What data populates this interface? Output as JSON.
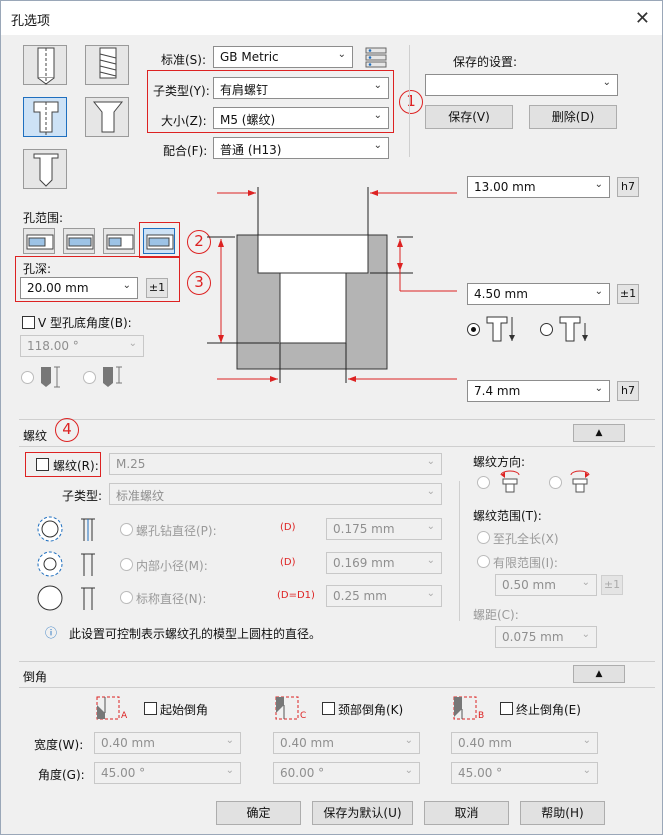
{
  "window": {
    "title": "孔选项",
    "close_glyph": "✕"
  },
  "top": {
    "standard_label": "标准(S):",
    "standard_value": "GB Metric",
    "subtype_label": "子类型(Y):",
    "subtype_value": "有肩螺钉",
    "size_label": "大小(Z):",
    "size_value": "M5 (螺纹)",
    "fit_label": "配合(F):",
    "fit_value": "普通 (H13)",
    "saved_label": "保存的设置:",
    "saved_value": "",
    "save_button": "保存(V)",
    "delete_button": "删除(D)"
  },
  "annotations": {
    "c1": "1",
    "c2": "2",
    "c3": "3",
    "c4": "4"
  },
  "range": {
    "label": "孔范围:",
    "depth_label": "孔深:",
    "depth_value": "20.00 mm",
    "pm": "±1",
    "vangle_label": "V 型孔底角度(B):",
    "vangle_value": "118.00 °"
  },
  "dims": {
    "d1": "13.00 mm",
    "d1_tol": "h7",
    "d2": "4.50 mm",
    "d2_tol": "±1",
    "d3": "7.4 mm",
    "d3_tol": "h7"
  },
  "thread": {
    "section": "螺纹",
    "collapse": "▲",
    "enable_label": "螺纹(R):",
    "value": "M.25",
    "subtype_label": "子类型:",
    "subtype_value": "标准螺纹",
    "tap_label": "螺孔钻直径(P):",
    "tap_code": "(D)",
    "tap_value": "0.175 mm",
    "minor_label": "内部小径(M):",
    "minor_code": "(D)",
    "minor_value": "0.169 mm",
    "major_label": "标称直径(N):",
    "major_code": "(D=D1)",
    "major_value": "0.25 mm",
    "info": "此设置可控制表示螺纹孔的模型上圆柱的直径。",
    "direction_label": "螺纹方向:",
    "range_label": "螺纹范围(T):",
    "full_label": "至孔全长(X)",
    "limited_label": "有限范围(I):",
    "limited_value": "0.50 mm",
    "limited_pm": "±1",
    "pitch_label": "螺距(C):",
    "pitch_value": "0.075 mm"
  },
  "chamfer": {
    "section": "倒角",
    "collapse": "▲",
    "start_label": "起始倒角",
    "neck_label": "颈部倒角(K)",
    "end_label": "终止倒角(E)",
    "tagA": "A",
    "tagC": "C",
    "tagB": "B",
    "width_label": "宽度(W):",
    "angle_label": "角度(G):",
    "w1": "0.40 mm",
    "w2": "0.40 mm",
    "w3": "0.40 mm",
    "a1": "45.00 °",
    "a2": "60.00 °",
    "a3": "45.00 °"
  },
  "footer": {
    "ok": "确定",
    "save_default": "保存为默认(U)",
    "cancel": "取消",
    "help": "帮助(H)"
  },
  "colors": {
    "accent": "#d22222",
    "selected": "#cde2f6"
  }
}
